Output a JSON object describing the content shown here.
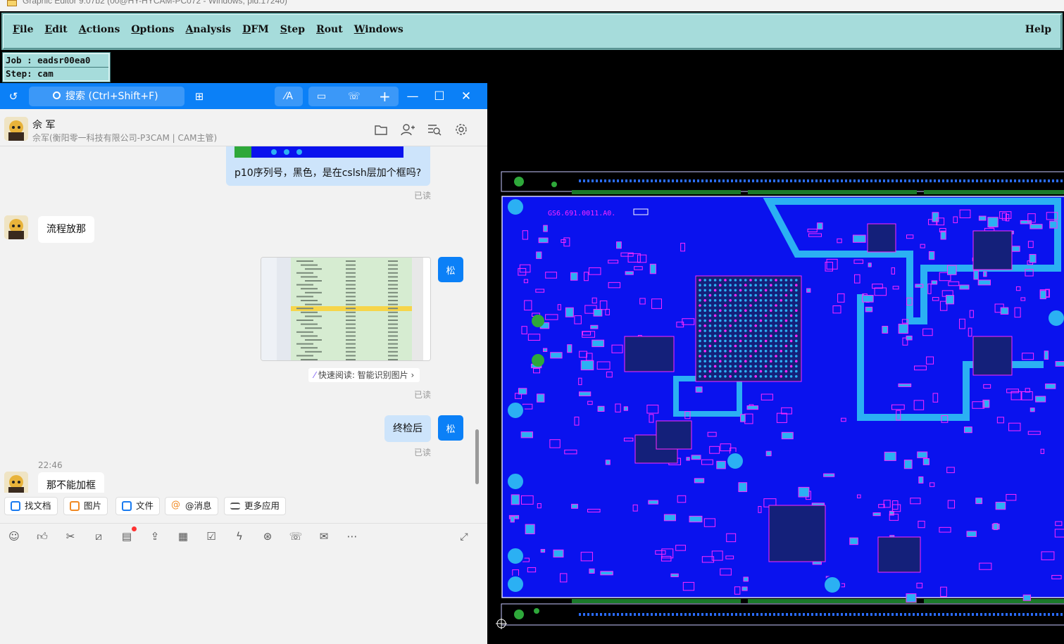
{
  "app": {
    "window_title": "Graphic Editor 9.07b2 (00@HY-HYCAM-PC072 - Windows, pid:17240)",
    "menu": [
      "File",
      "Edit",
      "Actions",
      "Options",
      "Analysis",
      "DFM",
      "Step",
      "Rout",
      "Windows"
    ],
    "help": "Help",
    "job_label": "Job : eadsr00ea0",
    "step_label": "Step: cam"
  },
  "chat": {
    "search_placeholder": "搜索 (Ctrl+Shift+F)",
    "contact_name": "佘 军",
    "contact_sub": "佘军(衡阳零一科技有限公司-P3CAM | CAM主管)",
    "my_avatar_text": "松",
    "messages": {
      "m1_text": "p10序列号，黑色，是在cslsh层加个框吗?",
      "m1_status": "已读",
      "m2_text": "流程放那",
      "m3_status": "已读",
      "quick_read": "快速阅读: 智能识别图片 ›",
      "m4_text": "终检后",
      "m4_status": "已读",
      "m5_time": "22:46",
      "m5_text": "那不能加框"
    },
    "chips": [
      "找文档",
      "图片",
      "文件",
      "@消息",
      "更多应用"
    ],
    "colors": {
      "accent": "#0b80f7",
      "my_bubble": "#cde4fb",
      "pcb_board": "#0a12ee",
      "pcb_pads": "#2bb0f3",
      "pcb_silk": "#ff28ff"
    }
  },
  "pcb": {
    "part_number": "GS6.691.0011.A0."
  }
}
